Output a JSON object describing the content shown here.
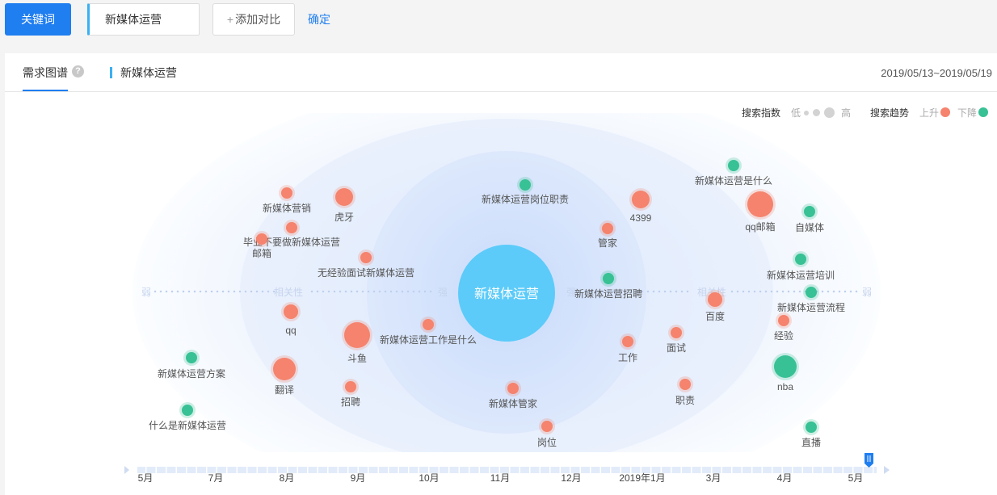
{
  "toolbar": {
    "keyword_button": "关键词",
    "keyword_value": "新媒体运营",
    "add_compare_plus": "+",
    "add_compare_label": "添加对比",
    "confirm": "确定"
  },
  "panel": {
    "tab": "需求图谱",
    "help_icon": "question-circle-icon",
    "keyword_tag": "新媒体运营",
    "date_range": "2019/05/13~2019/05/19"
  },
  "legend": {
    "index_title": "搜索指数",
    "low": "低",
    "high": "高",
    "trend_title": "搜索趋势",
    "up": "上升",
    "down": "下降",
    "up_color": "#f5836d",
    "down_color": "#38c194",
    "level_color": "#d3d3d3"
  },
  "chart_data": {
    "type": "bubble",
    "center": "新媒体运营",
    "axis_labels": {
      "weak_left": "弱",
      "rel_left": "相关性",
      "strong_left": "强",
      "strong_right": "强",
      "rel_right": "相关性",
      "weak_right": "弱"
    },
    "nodes": [
      {
        "label": "新媒体运营岗位职责",
        "trend": "down",
        "size": 1
      },
      {
        "label": "新媒体运营是什么",
        "trend": "down",
        "size": 1
      },
      {
        "label": "新媒体营销",
        "trend": "up",
        "size": 1
      },
      {
        "label": "虎牙",
        "trend": "up",
        "size": 3
      },
      {
        "label": "4399",
        "trend": "up",
        "size": 3
      },
      {
        "label": "qq邮箱",
        "trend": "up",
        "size": 5
      },
      {
        "label": "自媒体",
        "trend": "down",
        "size": 1
      },
      {
        "label": "管家",
        "trend": "up",
        "size": 1
      },
      {
        "label": "毕业不要做新媒体运营",
        "trend": "up",
        "size": 1
      },
      {
        "label": "邮箱",
        "trend": "up",
        "size": 1
      },
      {
        "label": "无经验面试新媒体运营",
        "trend": "up",
        "size": 1
      },
      {
        "label": "新媒体运营培训",
        "trend": "down",
        "size": 1
      },
      {
        "label": "新媒体运营招聘",
        "trend": "down",
        "size": 1
      },
      {
        "label": "新媒体运营流程",
        "trend": "down",
        "size": 1
      },
      {
        "label": "百度",
        "trend": "up",
        "size": 2
      },
      {
        "label": "qq",
        "trend": "up",
        "size": 2
      },
      {
        "label": "斗鱼",
        "trend": "up",
        "size": 5
      },
      {
        "label": "新媒体运营工作是什么",
        "trend": "up",
        "size": 1
      },
      {
        "label": "经验",
        "trend": "up",
        "size": 1
      },
      {
        "label": "工作",
        "trend": "up",
        "size": 1
      },
      {
        "label": "面试",
        "trend": "up",
        "size": 1
      },
      {
        "label": "新媒体运营方案",
        "trend": "down",
        "size": 1
      },
      {
        "label": "翻译",
        "trend": "up",
        "size": 4
      },
      {
        "label": "招聘",
        "trend": "up",
        "size": 1
      },
      {
        "label": "nba",
        "trend": "down",
        "size": 4
      },
      {
        "label": "职责",
        "trend": "up",
        "size": 1
      },
      {
        "label": "新媒体管家",
        "trend": "up",
        "size": 1
      },
      {
        "label": "什么是新媒体运营",
        "trend": "down",
        "size": 1
      },
      {
        "label": "岗位",
        "trend": "up",
        "size": 1
      },
      {
        "label": "直播",
        "trend": "down",
        "size": 1
      }
    ],
    "timeline": [
      "5月",
      "7月",
      "8月",
      "9月",
      "10月",
      "11月",
      "12月",
      "2019年1月",
      "3月",
      "4月",
      "5月"
    ]
  }
}
